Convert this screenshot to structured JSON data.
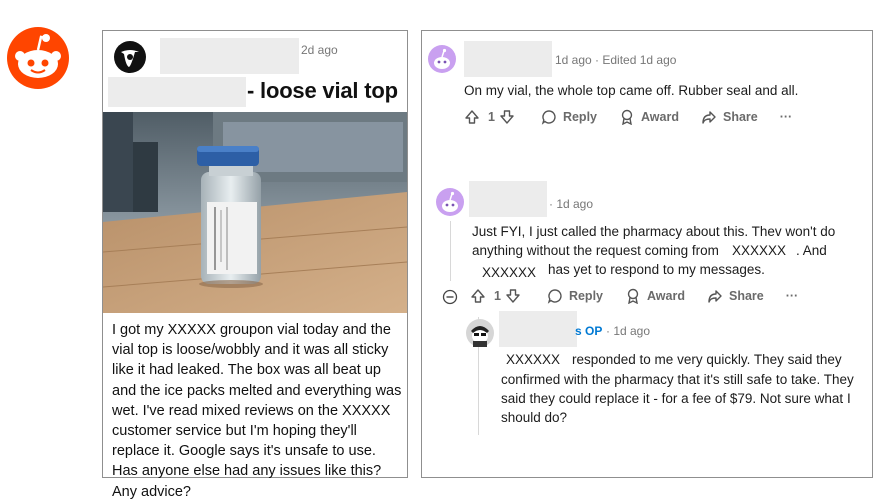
{
  "post": {
    "time": "2d ago",
    "title_suffix": "- loose vial top",
    "body": "I got my XXXXX groupon vial today and the vial top is loose/wobbly and it was all sticky like it had leaked. The box was all beat up and the ice packs melted and everything was wet. I've read mixed reviews on the XXXXX customer service but I'm hoping they'll replace it. Google says it's unsafe to use. Has anyone else had any issues like this? Any advice?",
    "image_alt": "photo of vial with blue cap on wooden table"
  },
  "comments": [
    {
      "meta": "1d ago · Edited 1d ago",
      "text": "On my vial, the whole top came off. Rubber seal and all.",
      "votes": "1",
      "reply": "Reply",
      "award": "Award",
      "share": "Share",
      "more": "···"
    },
    {
      "meta": "· 1d ago",
      "text_line1": "Just FYI, I just called the pharmacy about this. Thev won't do",
      "text_line2a": "anything without the request coming from",
      "redacted1": "XXXXXX",
      "text_line2b": ". And",
      "redacted2": "XXXXXX",
      "text_line3": "has yet to respond to my messages.",
      "votes": "1",
      "reply": "Reply",
      "award": "Award",
      "share": "Share",
      "more": "···"
    },
    {
      "op": "s OP",
      "meta": "· 1d ago",
      "redacted": "XXXXXX",
      "text_line1": "responded to me very quickly. They said they",
      "text_line2": "confirmed with the pharmacy that it's still safe to take. They",
      "text_line3": "said they could replace it - for a fee of $79. Not sure what I",
      "text_line4": "should do?"
    }
  ],
  "colors": {
    "reddit_orange": "#FF4500",
    "op_blue": "#0079D3",
    "avatar_purple": "#C9A0F0"
  }
}
